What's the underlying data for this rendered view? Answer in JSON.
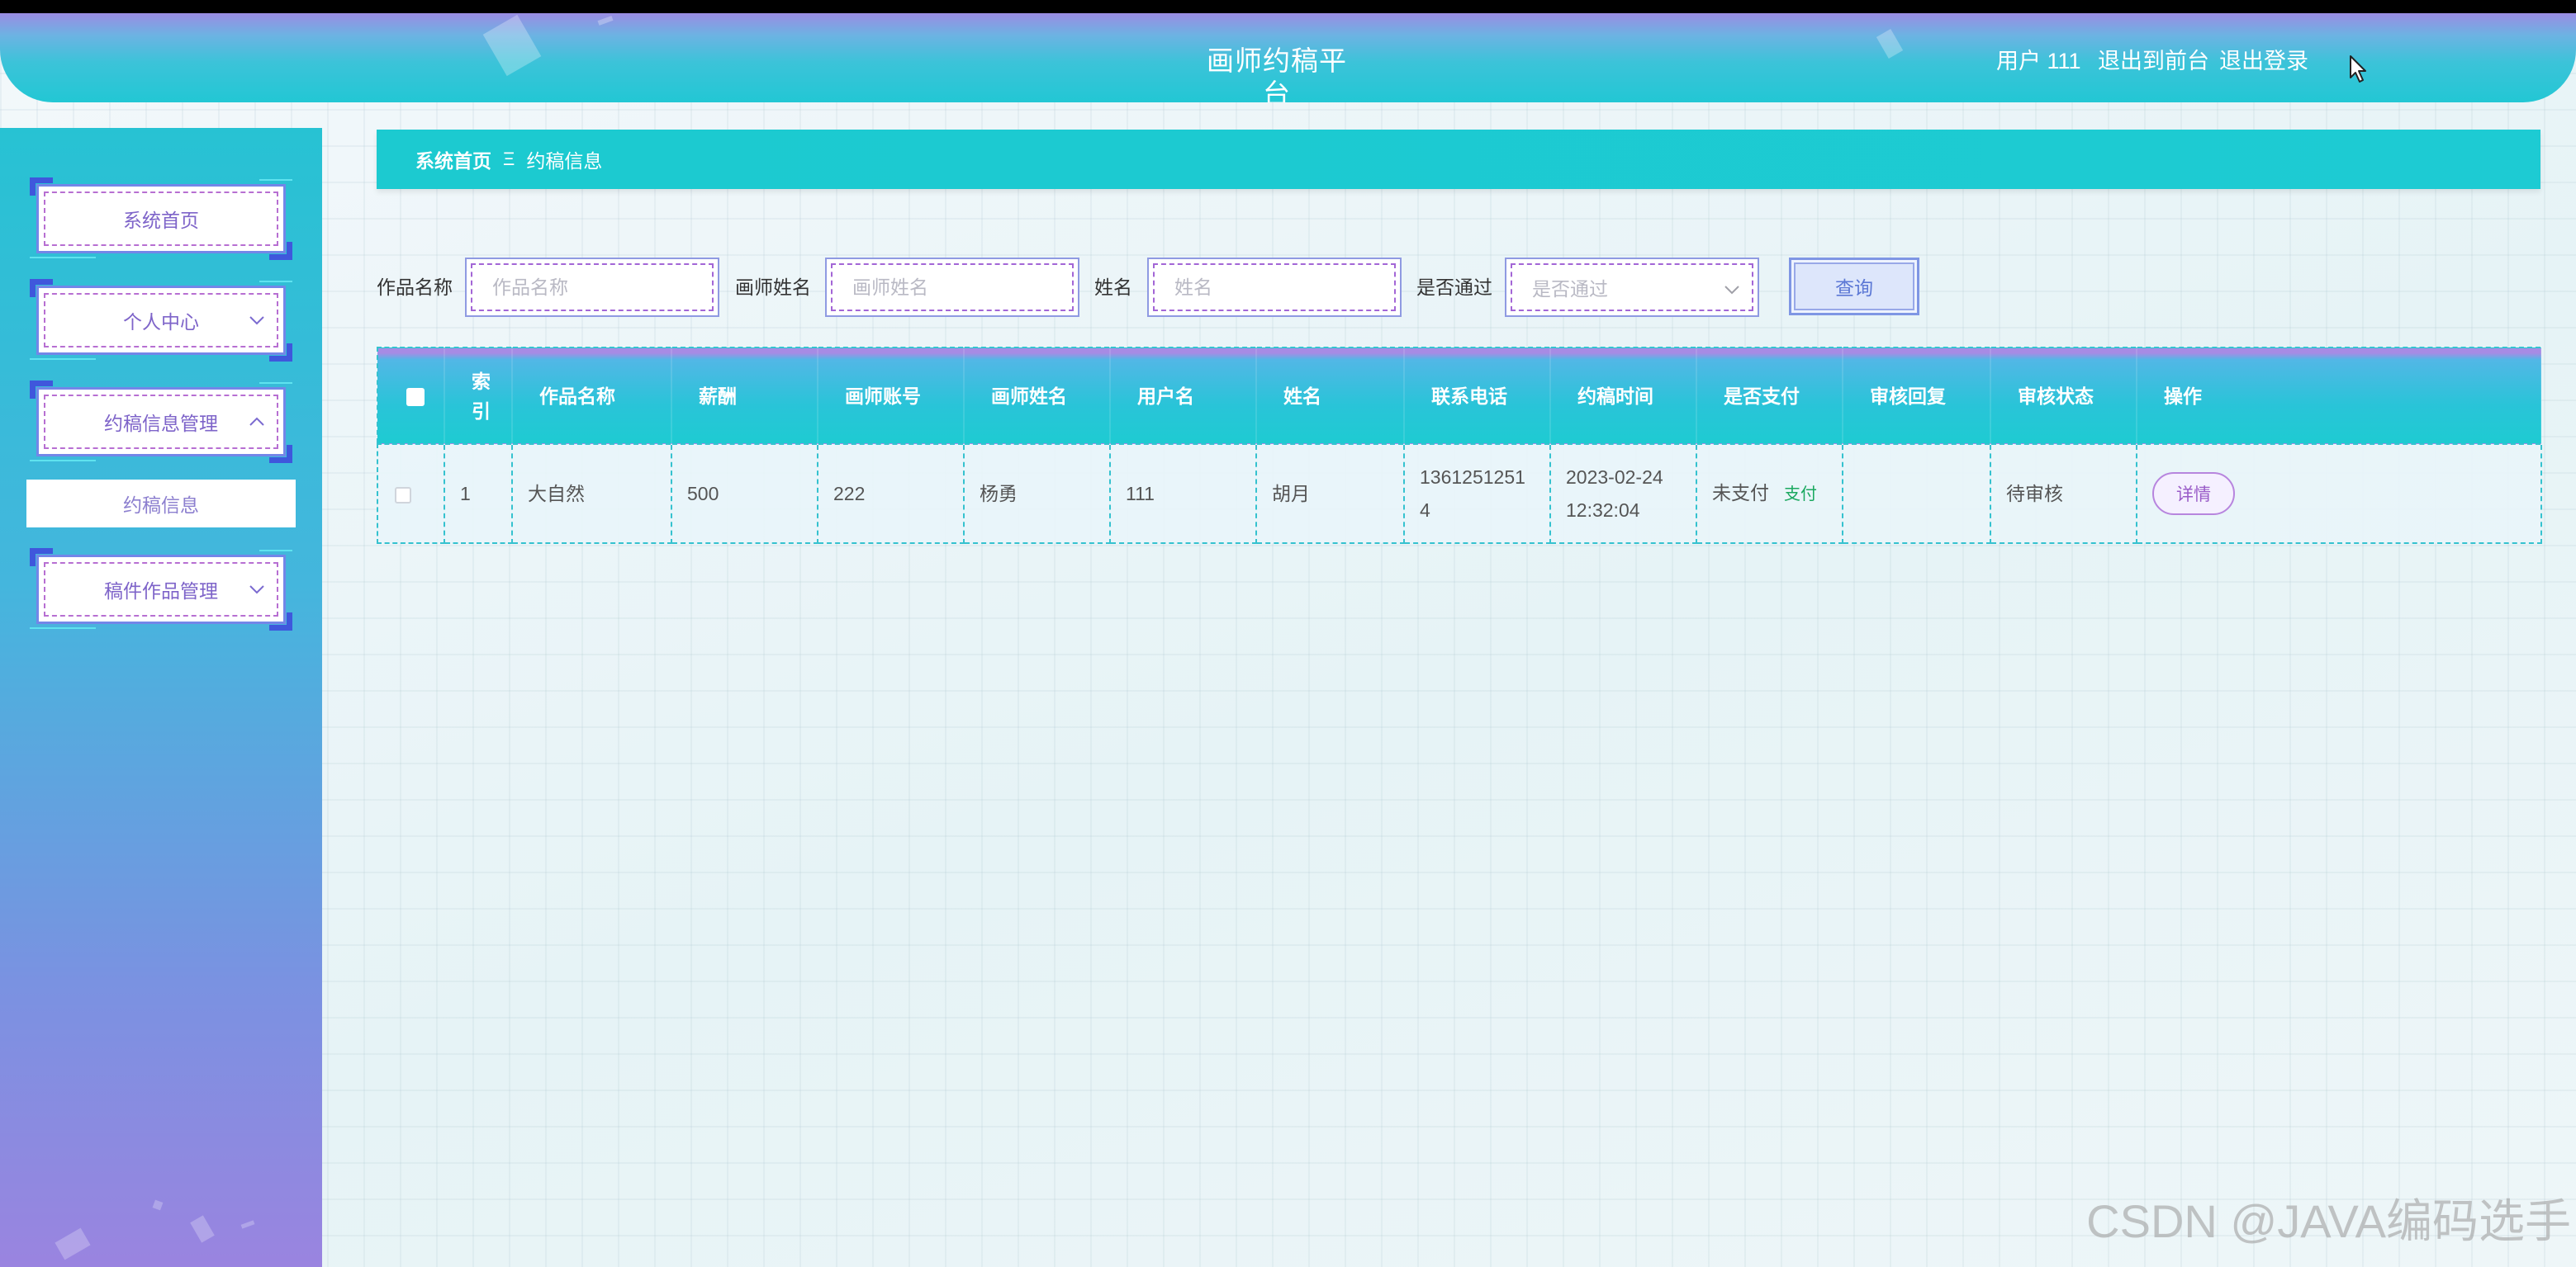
{
  "header": {
    "title": "画师约稿平台",
    "user_label": "用户 111",
    "front_link": "退出到前台",
    "logout": "退出登录"
  },
  "sidebar": {
    "items": [
      {
        "label": "系统首页",
        "icon": ""
      },
      {
        "label": "个人中心",
        "icon": "chevron-down-icon"
      },
      {
        "label": "约稿信息管理",
        "icon": "chevron-up-icon"
      },
      {
        "label": "稿件作品管理",
        "icon": "chevron-down-icon"
      }
    ],
    "submenu": [
      {
        "label": "约稿信息",
        "active": true
      }
    ]
  },
  "breadcrumb": {
    "home": "系统首页",
    "separator": "Ξ",
    "current": "约稿信息"
  },
  "search": {
    "fields": [
      {
        "label": "作品名称",
        "placeholder": "作品名称",
        "value": ""
      },
      {
        "label": "画师姓名",
        "placeholder": "画师姓名",
        "value": ""
      },
      {
        "label": "姓名",
        "placeholder": "姓名",
        "value": ""
      }
    ],
    "select": {
      "label": "是否通过",
      "placeholder": "是否通过"
    },
    "button": "查询"
  },
  "table": {
    "columns": [
      "索引",
      "作品名称",
      "薪酬",
      "画师账号",
      "画师姓名",
      "用户名",
      "姓名",
      "联系电话",
      "约稿时间",
      "是否支付",
      "审核回复",
      "审核状态",
      "操作"
    ],
    "rows": [
      {
        "index": "1",
        "work_name": "大自然",
        "salary": "500",
        "artist_account": "222",
        "artist_name": "杨勇",
        "username": "111",
        "name": "胡月",
        "phone": "13612512514",
        "time": "2023-02-24 12:32:04",
        "paid": "未支付",
        "pay_action": "支付",
        "review_reply": "",
        "review_status": "待审核",
        "detail": "详情"
      }
    ]
  },
  "watermark": "CSDN @JAVA编码选手",
  "icons": {
    "menu_expand": "chevron-down-icon",
    "menu_collapse": "chevron-up-icon",
    "select_arrow": "chevron-down-icon",
    "pointer": "mouse-cursor-icon"
  },
  "colors": {
    "header_top": "#9a8ce3",
    "header_bottom": "#22c7d4",
    "sidebar_top": "#27c2d3",
    "sidebar_bottom": "#9a84e0",
    "breadcrumb_bg": "#1ccad0",
    "accent_purple": "#b76fd2",
    "table_border": "#35c2cf",
    "pay_link": "#1aa85f"
  }
}
